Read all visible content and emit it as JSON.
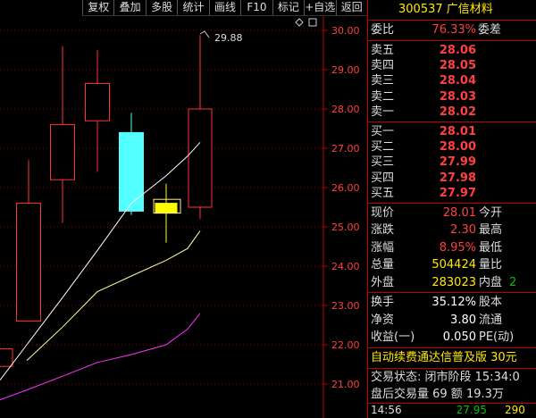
{
  "toolbar": [
    "复权",
    "叠加",
    "多股",
    "统计",
    "画线",
    "F10",
    "标记",
    "+自选",
    "返回"
  ],
  "chart_data": {
    "type": "candlestick",
    "y_ticks": [
      "30.00",
      "29.00",
      "28.00",
      "27.00",
      "26.00",
      "25.00",
      "24.00",
      "23.00",
      "22.00",
      "21.00"
    ],
    "ylim": [
      20.45,
      30.05
    ],
    "high_annotation": "29.88",
    "candles": [
      {
        "o": 21.9,
        "c": 21.45,
        "h": 21.9,
        "l": 21.45,
        "color": "#ff3333"
      },
      {
        "o": 22.6,
        "c": 25.6,
        "h": 26.7,
        "l": 22.6,
        "color": "#ff3333"
      },
      {
        "o": 26.2,
        "c": 27.6,
        "h": 29.6,
        "l": 25.1,
        "color": "#ff3333"
      },
      {
        "o": 27.7,
        "c": 28.65,
        "h": 29.5,
        "l": 26.4,
        "color": "#ff3333"
      },
      {
        "o": 27.4,
        "c": 25.4,
        "h": 27.9,
        "l": 25.3,
        "color": "#54ffff"
      },
      {
        "o": 25.6,
        "c": 25.35,
        "h": 26.1,
        "l": 24.6,
        "color": "#ffff00"
      },
      {
        "o": 25.5,
        "c": 28.0,
        "h": 29.88,
        "l": 25.2,
        "color": "#ff3333"
      }
    ],
    "ma": [
      {
        "color": "#ffffff",
        "values": [
          21.1,
          22.0,
          23.2,
          24.4,
          25.6,
          26.3,
          26.8,
          27.15
        ]
      },
      {
        "color": "#ffff99",
        "values": [
          null,
          21.6,
          22.45,
          23.35,
          23.75,
          24.15,
          24.45,
          24.9
        ]
      },
      {
        "color": "#ff33ff",
        "values": [
          20.6,
          20.85,
          21.2,
          21.55,
          21.75,
          22.0,
          22.4,
          22.8
        ]
      }
    ]
  },
  "panel": {
    "code_name": "300537 广信材料",
    "ratio_label": "委比",
    "ratio_value": "76.33%",
    "ratio_right": "委差",
    "asks": [
      {
        "label": "卖五",
        "price": "28.06"
      },
      {
        "label": "卖四",
        "price": "28.05"
      },
      {
        "label": "卖三",
        "price": "28.04"
      },
      {
        "label": "卖二",
        "price": "28.03"
      },
      {
        "label": "卖一",
        "price": "28.02"
      }
    ],
    "bids": [
      {
        "label": "买一",
        "price": "28.01"
      },
      {
        "label": "买二",
        "price": "28.00"
      },
      {
        "label": "买三",
        "price": "27.99"
      },
      {
        "label": "买四",
        "price": "27.98"
      },
      {
        "label": "买五",
        "price": "27.97"
      }
    ],
    "stats_a": [
      {
        "label": "现价",
        "value": "28.01",
        "right": "今开",
        "cls": "v"
      },
      {
        "label": "涨跌",
        "value": "2.30",
        "right": "最高",
        "cls": "v"
      },
      {
        "label": "涨幅",
        "value": "8.95%",
        "right": "最低",
        "cls": "v"
      },
      {
        "label": "总量",
        "value": "504424",
        "right": "量比",
        "cls": "v y"
      },
      {
        "label": "外盘",
        "value": "283023",
        "right": "内盘",
        "cls": "v y",
        "extra": "2"
      }
    ],
    "stats_b": [
      {
        "label": "换手",
        "value": "35.12%",
        "right": "股本",
        "cls": "v w"
      },
      {
        "label": "净资",
        "value": "3.80",
        "right": "流通",
        "cls": "v w"
      },
      {
        "label": "收益(一)",
        "value": "0.050",
        "right": "PE(动)",
        "cls": "v w"
      }
    ],
    "banner": "自动续费通达信普及版 30元",
    "status_line": "交易状态: 闭市阶段 15:34:0",
    "after_hours": "盘后交易量 69 额 19.3万",
    "tick": {
      "time": "14:56",
      "price": "27.95",
      "vol": "290"
    }
  }
}
